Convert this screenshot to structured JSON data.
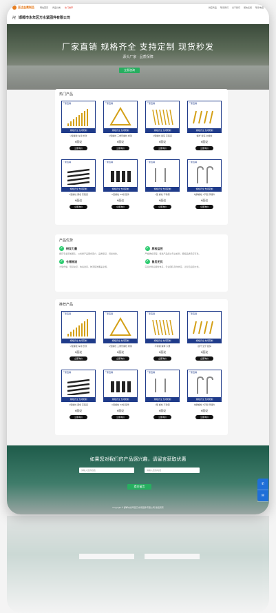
{
  "topbar": {
    "logo": "亚达金属制品",
    "nav": [
      "网站首页",
      "商品分类",
      "热门推荐"
    ],
    "right": [
      "供应商品",
      "联系我们",
      "关于我们",
      "留言反馈",
      "联系电话"
    ]
  },
  "header": {
    "company": "邯郸市永年区万水紧固件有限公司"
  },
  "hero": {
    "title": "厂家直销 规格齐全 支持定制 现货秒发",
    "subtitle": "源头厂家 · 品质保障",
    "cta": "立即咨询"
  },
  "hot": {
    "title": "热门产品",
    "items": [
      {
        "name": "U型螺栓 车用 长款",
        "price": "¥面议",
        "buy": "立即询价"
      },
      {
        "name": "U型螺栓 三角形螺栓 桥架",
        "price": "¥面议",
        "buy": "立即询价"
      },
      {
        "name": "U型螺栓 镀锌 高强度",
        "price": "¥面议",
        "buy": "立即询价"
      },
      {
        "name": "螺杆 镀锌 全螺纹",
        "price": "¥面议",
        "buy": "立即询价"
      },
      {
        "name": "U型螺栓 黑色 高强度",
        "price": "¥面议",
        "buy": "立即询价"
      },
      {
        "name": "U型螺栓 8.8级 配件",
        "price": "¥面议",
        "buy": "立即询价"
      },
      {
        "name": "J型 螺栓 不锈钢",
        "price": "¥面议",
        "buy": "立即询价"
      },
      {
        "name": "地脚螺栓 7字型 预埋件",
        "price": "¥面议",
        "buy": "立即询价"
      }
    ]
  },
  "advantages": {
    "title": "产品优势",
    "items": [
      {
        "heading": "研发力量",
        "desc": "拥有专业研发团队，以优质产品服务客户，品质保证，持续创新。"
      },
      {
        "heading": "质检监控",
        "desc": "严格质检流程，每批产品经过专业检测，确保品质稳定可靠。"
      },
      {
        "heading": "仓储物流",
        "desc": "大型仓储，现货充足，快速发货，物流配送覆盖全国。"
      },
      {
        "heading": "售后无忧",
        "desc": "完善的售后服务体系，专业团队及时响应，让您无后顾之忧。"
      }
    ]
  },
  "recommend": {
    "title": "推荐产品",
    "items": [
      {
        "name": "U型螺栓 车用 长款",
        "price": "¥面议",
        "buy": "立即询价"
      },
      {
        "name": "U型螺栓 三角形螺栓 桥架",
        "price": "¥面议",
        "buy": "立即询价"
      },
      {
        "name": "不锈钢 螺母 六角",
        "price": "¥面议",
        "buy": "立即询价"
      },
      {
        "name": "丝杆 全牙 镀锌",
        "price": "¥面议",
        "buy": "立即询价"
      },
      {
        "name": "U型螺栓 黑色 高强度",
        "price": "¥面议",
        "buy": "立即询价"
      },
      {
        "name": "U型螺栓 8.8级 配件",
        "price": "¥面议",
        "buy": "立即询价"
      },
      {
        "name": "J型 螺栓 不锈钢",
        "price": "¥面议",
        "buy": "立即询价"
      },
      {
        "name": "地脚螺栓 7字型 预埋件",
        "price": "¥面议",
        "buy": "立即询价"
      }
    ]
  },
  "thumb": {
    "tag": "厂家直销",
    "bar": "规格齐全 支持定制"
  },
  "footer": {
    "question": "如果您对我们的产品感兴趣，请留言获取优惠",
    "name_placeholder": "请输入您的姓名",
    "phone_placeholder": "请输入您的电话",
    "submit": "提交留言",
    "copyright": "Copyright © 邯郸市永年区万水紧固件有限公司 版权所有"
  },
  "side": {
    "phone_icon": "phone-icon",
    "mail_icon": "mail-icon"
  },
  "colors": {
    "accent": "#27ae60",
    "brand": "#e67e22",
    "thumb_border": "#1f3b8a",
    "side": "#1f6fd8"
  }
}
